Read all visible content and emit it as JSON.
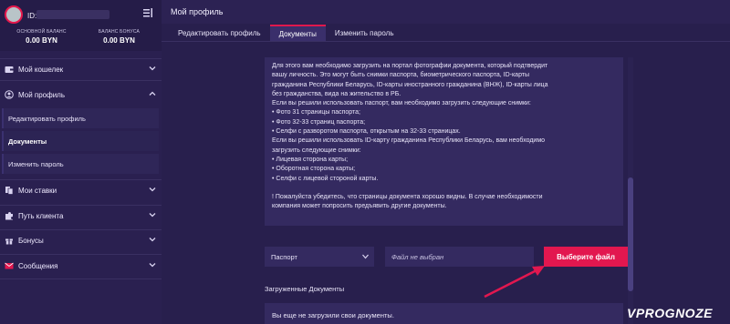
{
  "user": {
    "id_label": "ID:"
  },
  "balances": [
    {
      "label": "ОСНОВНОЙ БАЛАНС",
      "value": "0.00 BYN"
    },
    {
      "label": "БАЛАНС БОНУСА",
      "value": "0.00 BYN"
    }
  ],
  "sidebar": {
    "wallet": "Мой кошелек",
    "profile": "Мой профиль",
    "sub": [
      "Редактировать профиль",
      "Документы",
      "Изменить пароль"
    ],
    "bets": "Мои ставки",
    "client_path": "Путь клиента",
    "bonuses": "Бонусы",
    "messages": "Сообщения"
  },
  "page": {
    "title": "Мой профиль",
    "tabs": [
      "Редактировать профиль",
      "Документы",
      "Изменить пароль"
    ],
    "active_tab": "Документы"
  },
  "info_lines": [
    "Для этого вам необходимо загрузить на портал фотографии документа, который подтвердит",
    "вашу личность. Это могут быть снимки паспорта, биометрического паспорта, ID-карты",
    "гражданина Республики Беларусь, ID-карты иностранного гражданина (ВНЖ), ID-карты лица",
    "без гражданства, вида на жительство в РБ.",
    "Если вы решили использовать паспорт, вам необходимо загрузить следующие снимки:",
    "• Фото 31 страницы паспорта;",
    "• Фото 32-33 страниц паспорта;",
    "• Селфи с разворотом паспорта, открытым на 32-33 страницах.",
    "Если вы решили использовать ID-карту гражданина Республики Беларусь, вам необходимо",
    "загрузить следующие снимки:",
    "• Лицевая сторона карты;",
    "• Оборотная сторона карты;",
    "• Селфи с лицевой стороной карты.",
    "",
    "! Пожалуйста убедитесь, что страницы документа хорошо видны. В случае необходимости",
    "компания может попросить предъявить другие документы."
  ],
  "upload": {
    "doc_type": "Паспорт",
    "file_placeholder": "Файл не выбран",
    "choose_button": "Выберите файл"
  },
  "uploaded": {
    "title": "Загруженные Документы",
    "empty_text": "Вы еще не загрузили свои документы."
  },
  "watermark": "VPROGNOZE",
  "colors": {
    "accent": "#e2174f",
    "background": "#241b46",
    "panel": "#342a60"
  }
}
